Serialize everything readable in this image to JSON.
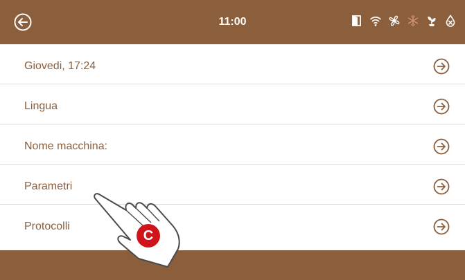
{
  "status_bar": {
    "time": "11:00",
    "icons": [
      "door-icon",
      "wifi-icon",
      "fan-icon",
      "snowflake-icon",
      "plant-icon",
      "water-drop-icon"
    ]
  },
  "menu": {
    "items": [
      {
        "label": "Giovedi, 17:24"
      },
      {
        "label": "Lingua"
      },
      {
        "label": "Nome macchina:"
      },
      {
        "label": "Parametri"
      },
      {
        "label": "Protocolli"
      }
    ]
  },
  "annotation": {
    "letter": "C"
  },
  "colors": {
    "brand": "#8b5e3c",
    "divider": "#e3d9d0",
    "badge": "#d0141b"
  }
}
